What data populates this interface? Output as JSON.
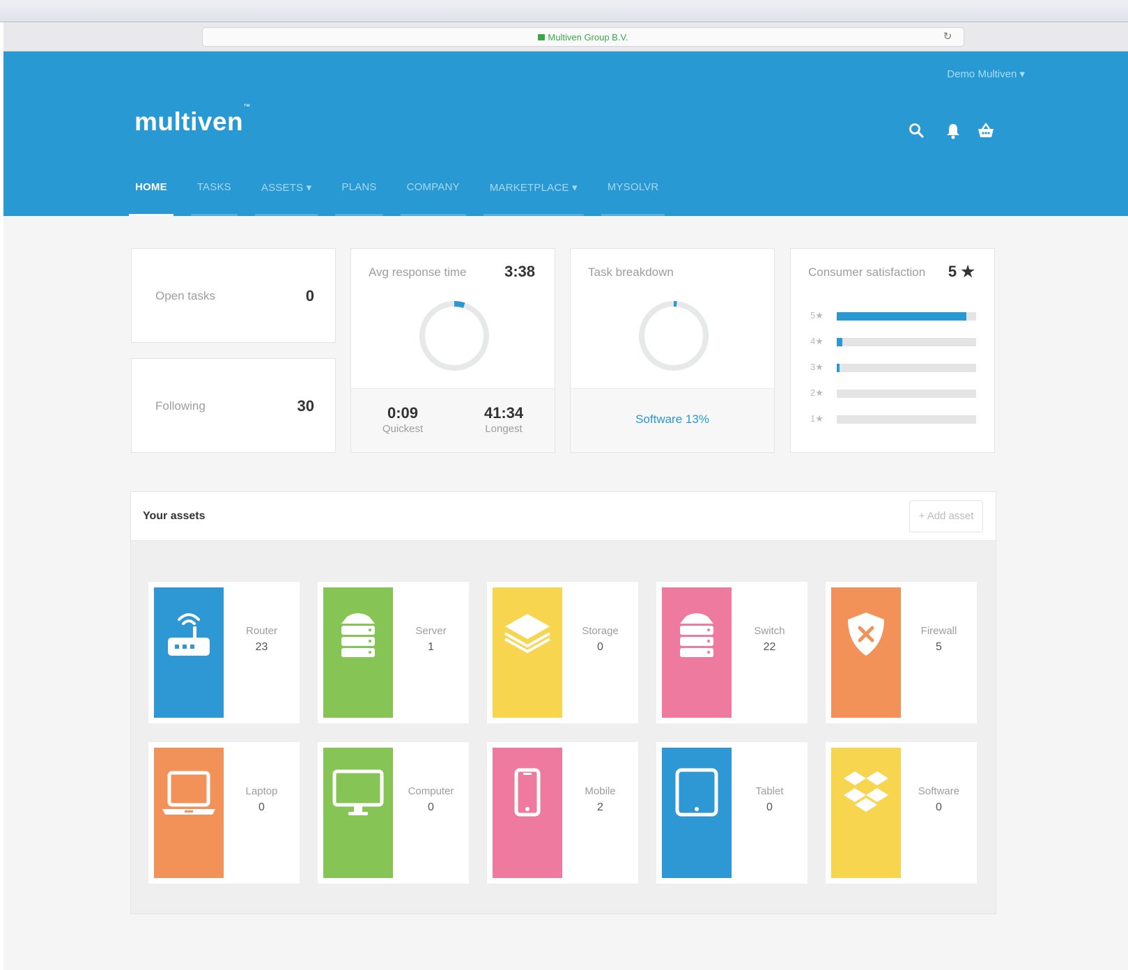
{
  "browser": {
    "url_label": "Multiven Group B.V."
  },
  "header": {
    "user_menu": "Demo Multiven ▾",
    "logo": "multiven",
    "logo_mark": "™",
    "icons": [
      "search-icon",
      "bell-icon",
      "basket-icon"
    ]
  },
  "nav": {
    "items": [
      {
        "label": "HOME"
      },
      {
        "label": "TASKS"
      },
      {
        "label": "ASSETS ▾"
      },
      {
        "label": "PLANS"
      },
      {
        "label": "COMPANY"
      },
      {
        "label": "MARKETPLACE ▾"
      },
      {
        "label": "MYSOLVR"
      }
    ]
  },
  "stats": {
    "open_tasks": {
      "label": "Open tasks",
      "value": "0"
    },
    "following": {
      "label": "Following",
      "value": "30"
    },
    "response": {
      "label": "Avg response time",
      "value": "3:38",
      "quickest_value": "0:09",
      "quickest_label": "Quickest",
      "longest_value": "41:34",
      "longest_label": "Longest",
      "ring_fraction": 0.05
    },
    "breakdown": {
      "label": "Task breakdown",
      "link": "Software 13%",
      "ring_fraction": 0.015
    },
    "satisfaction": {
      "label": "Consumer satisfaction",
      "value": "5 ★",
      "rows": [
        {
          "label": "5★",
          "fraction": 0.93
        },
        {
          "label": "4★",
          "fraction": 0.04
        },
        {
          "label": "3★",
          "fraction": 0.01
        },
        {
          "label": "2★",
          "fraction": 0
        },
        {
          "label": "1★",
          "fraction": 0
        }
      ]
    }
  },
  "assets": {
    "title": "Your assets",
    "add_label": "+ Add asset",
    "items": [
      {
        "label": "Router",
        "count": "23",
        "color": "#2e98d4",
        "icon": "router-icon"
      },
      {
        "label": "Server",
        "count": "1",
        "color": "#86c455",
        "icon": "server-icon"
      },
      {
        "label": "Storage",
        "count": "0",
        "color": "#f7d54f",
        "icon": "storage-icon"
      },
      {
        "label": "Switch",
        "count": "22",
        "color": "#ef7aa0",
        "icon": "switch-icon"
      },
      {
        "label": "Firewall",
        "count": "5",
        "color": "#f29158",
        "icon": "firewall-icon"
      },
      {
        "label": "Laptop",
        "count": "0",
        "color": "#f29158",
        "icon": "laptop-icon"
      },
      {
        "label": "Computer",
        "count": "0",
        "color": "#86c455",
        "icon": "computer-icon"
      },
      {
        "label": "Mobile",
        "count": "2",
        "color": "#ef7aa0",
        "icon": "mobile-icon"
      },
      {
        "label": "Tablet",
        "count": "0",
        "color": "#2e98d4",
        "icon": "tablet-icon"
      },
      {
        "label": "Software",
        "count": "0",
        "color": "#f7d54f",
        "icon": "software-icon"
      }
    ]
  }
}
